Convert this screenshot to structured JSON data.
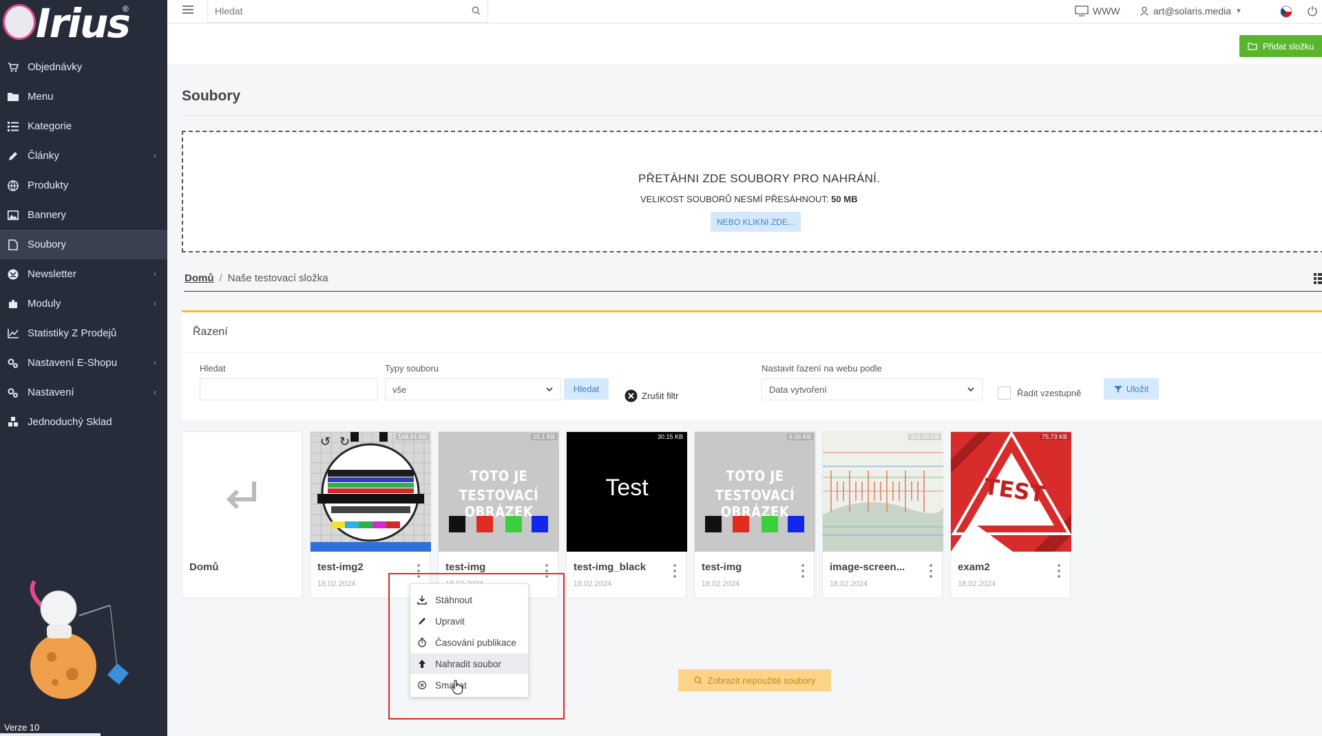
{
  "app": {
    "logo_text": "Irius",
    "version": "Verze 10"
  },
  "sidebar": {
    "items": [
      {
        "label": "Objednávky",
        "icon": "cart-icon",
        "chevron": false,
        "active": false
      },
      {
        "label": "Menu",
        "icon": "folder-icon",
        "chevron": false,
        "active": false
      },
      {
        "label": "Kategorie",
        "icon": "list-icon",
        "chevron": false,
        "active": false
      },
      {
        "label": "Články",
        "icon": "pencil-icon",
        "chevron": true,
        "active": false
      },
      {
        "label": "Produkty",
        "icon": "globe-icon",
        "chevron": false,
        "active": false
      },
      {
        "label": "Bannery",
        "icon": "image-icon",
        "chevron": false,
        "active": false
      },
      {
        "label": "Soubory",
        "icon": "file-icon",
        "chevron": false,
        "active": true
      },
      {
        "label": "Newsletter",
        "icon": "newsletter-icon",
        "chevron": true,
        "active": false
      },
      {
        "label": "Moduly",
        "icon": "puzzle-icon",
        "chevron": true,
        "active": false
      },
      {
        "label": "Statistiky Z Prodejů",
        "icon": "chart-icon",
        "chevron": false,
        "active": false
      },
      {
        "label": "Nastavení E-Shopu",
        "icon": "gears-icon",
        "chevron": true,
        "active": false
      },
      {
        "label": "Nastavení",
        "icon": "gears-icon",
        "chevron": true,
        "active": false
      },
      {
        "label": "Jednoduchý Sklad",
        "icon": "boxes-icon",
        "chevron": false,
        "active": false
      }
    ]
  },
  "topbar": {
    "search_placeholder": "Hledat",
    "www_label": "WWW",
    "user_email": "art@solaris.media"
  },
  "actions": {
    "add_folder": "Přidat složku"
  },
  "page": {
    "title": "Soubory"
  },
  "dropzone": {
    "title": "PŘETÁHNI ZDE SOUBORY PRO NAHRÁNÍ.",
    "limit_text": "VELIKOST SOUBORŮ NESMÍ PŘESÁHNOUT:",
    "limit_value": "50 MB",
    "button": "NEBO KLIKNI ZDE..."
  },
  "breadcrumb": {
    "home": "Domů",
    "separator": "/",
    "current": "Naše testovací složka"
  },
  "sorting": {
    "title": "Řazení",
    "search_label": "Hledat",
    "search_value": "",
    "type_label": "Typy souboru",
    "type_value": "vše",
    "search_button": "Hledat",
    "cancel_filter": "Zrušit filtr",
    "order_label": "Nastavit řazení na webu podle",
    "order_value": "Data vytvoření",
    "ascending_label": "Řadit vzestupně",
    "ascending_checked": false,
    "save_button": "Uložit"
  },
  "files": [
    {
      "name": "Domů",
      "type": "back"
    },
    {
      "name": "test-img2",
      "date": "18.02.2024",
      "size": "144.41 KB",
      "type": "testcard"
    },
    {
      "name": "test-img",
      "date": "18.02.2024",
      "size": "15.1 KB",
      "type": "testimg"
    },
    {
      "name": "test-img_black",
      "date": "18.02.2024",
      "size": "30.15 KB",
      "type": "black",
      "thumb_text": "Test"
    },
    {
      "name": "test-img",
      "date": "18.02.2024",
      "size": "6.56 KB",
      "type": "testimg"
    },
    {
      "name": "image-screen...",
      "date": "18.02.2024",
      "size": "304.06 KB",
      "type": "screen"
    },
    {
      "name": "exam2",
      "date": "18.02.2024",
      "size": "75.73 KB",
      "type": "sign",
      "thumb_text": "TEST"
    }
  ],
  "testimg_text": {
    "line1": "TOTO JE",
    "line2": "TESTOVACÍ OBRÁZEK"
  },
  "context_menu": {
    "items": [
      {
        "label": "Stáhnout",
        "icon": "download-icon"
      },
      {
        "label": "Upravit",
        "icon": "edit-icon"
      },
      {
        "label": "Časování publikace",
        "icon": "timer-icon"
      },
      {
        "label": "Nahradit soubor",
        "icon": "upload-icon"
      },
      {
        "label": "Smazat",
        "icon": "delete-icon"
      }
    ],
    "hovered_index": 3
  },
  "unused_files_button": "Zobrazit nepoužité soubory",
  "colors": {
    "sidebar": "#272c3a",
    "accent_green": "#5ab42d",
    "accent_yellow": "#f2c31f",
    "highlight_red": "#e0251b"
  }
}
